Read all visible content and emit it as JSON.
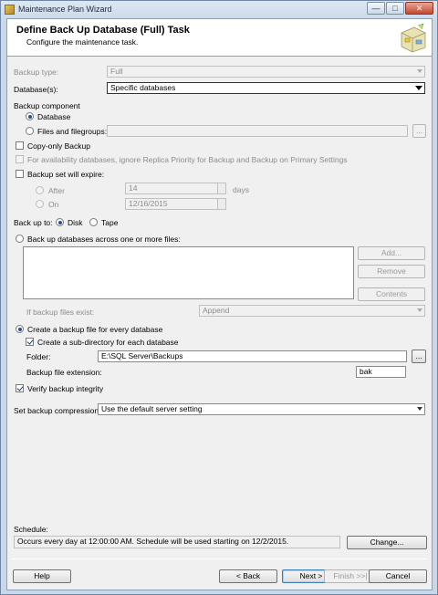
{
  "window": {
    "title": "Maintenance Plan Wizard",
    "minimize_glyph": "—",
    "maximize_glyph": "□",
    "close_glyph": "✕"
  },
  "header": {
    "title": "Define Back Up Database (Full) Task",
    "subtitle": "Configure the maintenance task.",
    "icon": "wizard-graphic-icon"
  },
  "form": {
    "backup_type_label": "Backup type:",
    "backup_type_value": "Full",
    "databases_label": "Database(s):",
    "databases_value": "Specific databases",
    "backup_component_label": "Backup component",
    "component_database": "Database",
    "component_files": "Files and filegroups:",
    "browse_glyph": "...",
    "copy_only": "Copy-only Backup",
    "availability_note": "For availability databases, ignore Replica Priority for Backup and Backup on Primary Settings",
    "expire_label": "Backup set will expire:",
    "after_label": "After",
    "after_value": "14",
    "days_label": "days",
    "on_label": "On",
    "on_value": "12/16/2015",
    "backup_to_label": "Back up to:",
    "disk_label": "Disk",
    "tape_label": "Tape",
    "across_files_label": "Back up databases across one or more files:",
    "add_button": "Add...",
    "remove_button": "Remove",
    "contents_button": "Contents",
    "if_exist_label": "If backup files exist:",
    "if_exist_value": "Append",
    "create_per_db": "Create a backup file for every database",
    "create_subdir": "Create a sub-directory for each database",
    "folder_label": "Folder:",
    "folder_value": "E:\\SQL Server\\Backups",
    "extension_label": "Backup file extension:",
    "extension_value": "bak",
    "verify_integrity": "Verify backup integrity",
    "compression_label": "Set backup compression:",
    "compression_value": "Use the default server setting"
  },
  "schedule": {
    "label": "Schedule:",
    "text": "Occurs every day at 12:00:00 AM. Schedule will be used starting on 12/2/2015.",
    "change_button": "Change..."
  },
  "footer": {
    "help": "Help",
    "back": "< Back",
    "next": "Next >",
    "finish": "Finish >>|",
    "cancel": "Cancel"
  }
}
